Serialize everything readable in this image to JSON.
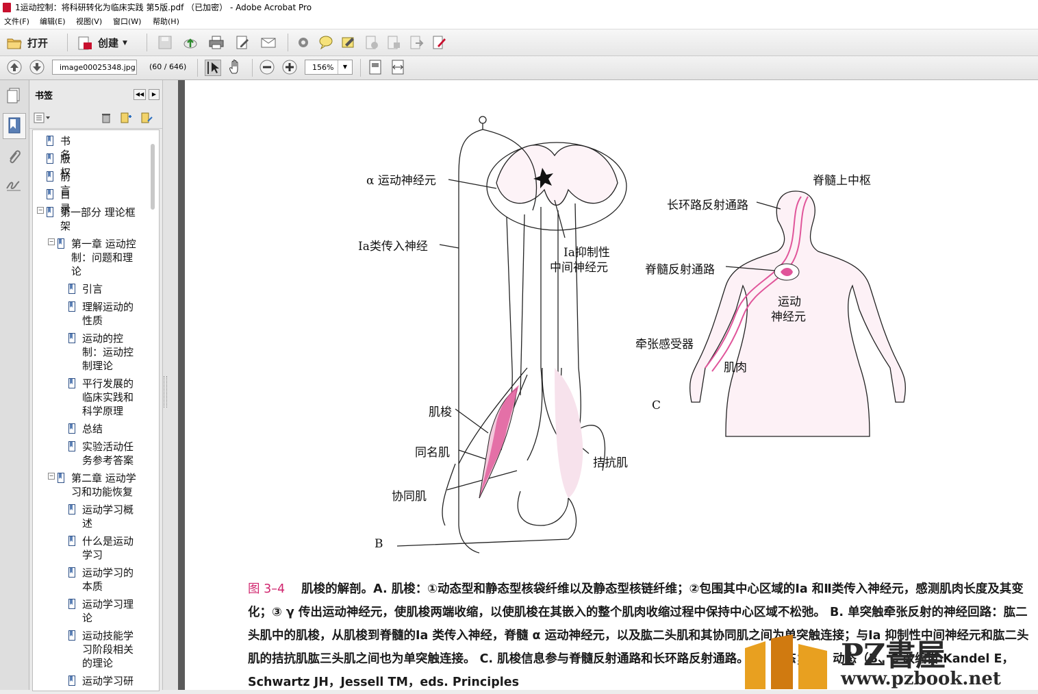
{
  "window": {
    "title": "1运动控制：将科研转化为临床实践 第5版.pdf （已加密） - Adobe Acrobat Pro"
  },
  "menu": [
    "文件(F)",
    "编辑(E)",
    "视图(V)",
    "窗口(W)",
    "帮助(H)"
  ],
  "toolbar": {
    "open_label": "打开",
    "create_label": "创建",
    "page_field": "image00025348.jpg",
    "page_count": "(60 / 646)",
    "zoom": "156%"
  },
  "panel": {
    "title": "书签"
  },
  "bookmarks": [
    {
      "label": "书名"
    },
    {
      "label": "版权"
    },
    {
      "label": "前言"
    },
    {
      "label": "目录"
    },
    {
      "label": "第一部分 理论框架"
    },
    {
      "label": "第一章 运动控制：问题和理论"
    },
    {
      "label": "引言"
    },
    {
      "label": "理解运动的性质"
    },
    {
      "label": "运动的控制：运动控制理论"
    },
    {
      "label": "平行发展的临床实践和科学原理"
    },
    {
      "label": "总结"
    },
    {
      "label": "实验活动任务参考答案"
    },
    {
      "label": "第二章 运动学习和功能恢复"
    },
    {
      "label": "运动学习概述"
    },
    {
      "label": "什么是运动学习"
    },
    {
      "label": "运动学习的本质"
    },
    {
      "label": "运动学习理论"
    },
    {
      "label": "运动技能学习阶段相关的理论"
    },
    {
      "label": "运动学习研"
    }
  ],
  "figure": {
    "labels": {
      "alpha_motor": "α 运动神经元",
      "ia_afferent": "Ⅰa类传入神经",
      "ia_inhibitory_1": "Ⅰa抑制性",
      "ia_inhibitory_2": "中间神经元",
      "spindle": "肌梭",
      "homonymous": "同名肌",
      "synergist": "协同肌",
      "antagonist": "拮抗肌",
      "panel_b": "B",
      "supraspinal": "脊髓上中枢",
      "long_loop": "长环路反射通路",
      "spinal_reflex": "脊髓反射通路",
      "motor_neuron_1": "运动",
      "motor_neuron_2": "神经元",
      "stretch_receptor": "牵张感受器",
      "muscle": "肌肉",
      "panel_c": "C"
    },
    "caption_num": "图 3–4",
    "caption_text": "肌梭的解剖。A. 肌梭：①动态型和静态型核袋纤维以及静态型核链纤维；②包围其中心区域的Ⅰa 和Ⅱ类传入神经元，感测肌肉长度及其变化；③ γ 传出运动神经元，使肌梭两端收缩，以使肌梭在其嵌入的整个肌肉收缩过程中保持中心区域不松弛。 B. 单突触牵张反射的神经回路：肱二头肌中的肌梭，从肌梭到脊髓的Ⅰa 类传入神经，脊髓 α 运动神经元，以及肱二头肌和其协同肌之间为单突触连接；与Ⅰa 抑制性中间神经元和肱二头肌的拮抗肌肱三头肌之间也为单突触连接。 C. 肌梭信息参与脊髓反射通路和长环路反射通路。 s，静态； d，动态（B、C 改编自 Kandel E，Schwartz JH，Jessell TM，eds. Principles"
  },
  "watermark": {
    "text": "PZ書屋",
    "url": "www.pzbook.net"
  }
}
